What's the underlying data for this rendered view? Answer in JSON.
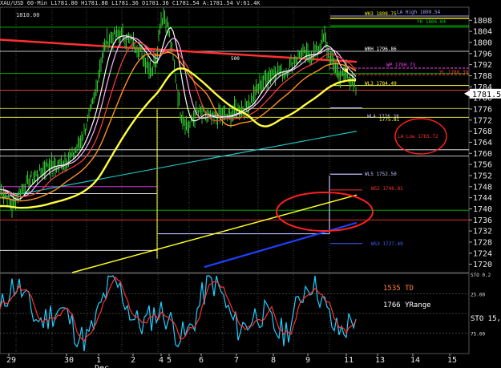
{
  "window": {
    "title": "XAU/USD 60-Min",
    "header_text": "XAU/USD 60-Min  L1781.80 H1781.88 L1781.36 O1781.36 C1781.54  A:1781.54 V:61.4K",
    "sub_header": "1810.00"
  },
  "chart_data": {
    "type": "line",
    "symbol": "XAU/USD",
    "timeframe": "60-Min",
    "price_axis": {
      "ylim": [
        1717,
        1813
      ],
      "ticks": [
        1720,
        1724,
        1728,
        1732,
        1736,
        1740,
        1744,
        1748,
        1752,
        1756,
        1760,
        1764,
        1768,
        1772,
        1776,
        1780,
        1784,
        1788,
        1792,
        1796,
        1800,
        1804,
        1808
      ],
      "last_price": "1781.54"
    },
    "date_axis": {
      "labels": [
        "29",
        "30",
        "1",
        "2",
        "4",
        "5",
        "6",
        "7",
        "8",
        "9",
        "11",
        "13",
        "14",
        "15"
      ],
      "month_label": "Dec"
    },
    "horizontal_levels": [
      {
        "label": "WH3 1808.75",
        "value": 1808.75,
        "color": "#f0f000"
      },
      {
        "label": "YH 1806.04",
        "value": 1806.04,
        "color": "#00d000"
      },
      {
        "label": "LA High 1809.54",
        "value": 1809.54,
        "color": "#a0a0ff"
      },
      {
        "label": "WRH 1796.86",
        "value": 1796.86,
        "color": "#ffffff"
      },
      {
        "label": "500",
        "value": 1794.0,
        "color": "#ffffff"
      },
      {
        "label": "WP 1790.73",
        "value": 1790.73,
        "color": "#ff40ff"
      },
      {
        "label": "YL 1788.39",
        "value": 1788.39,
        "color": "#ff4040"
      },
      {
        "label": "WL3 1784.49",
        "value": 1784.49,
        "color": "#ffff40"
      },
      {
        "label": "WL4 1776.38",
        "value": 1776.38,
        "color": "#c0c0ff"
      },
      {
        "label": "1775.81",
        "value": 1775.81,
        "color": "#ffff40"
      },
      {
        "label": "LA Low 1765.72",
        "value": 1765.72,
        "color": "#ff3030"
      },
      {
        "label": "WL5 1752.50",
        "value": 1752.5,
        "color": "#c0c0ff"
      },
      {
        "label": "WS2 1746.81",
        "value": 1746.81,
        "color": "#ff3030"
      },
      {
        "label": "WS3 1727.49",
        "value": 1727.49,
        "color": "#4060ff"
      }
    ],
    "annotations": [
      "1535 TD",
      "1766 YRange"
    ],
    "oscillator": {
      "label": "STO  15,",
      "ticks": [
        "25.00",
        "75.00"
      ],
      "top_label": "STO 0.2"
    }
  }
}
